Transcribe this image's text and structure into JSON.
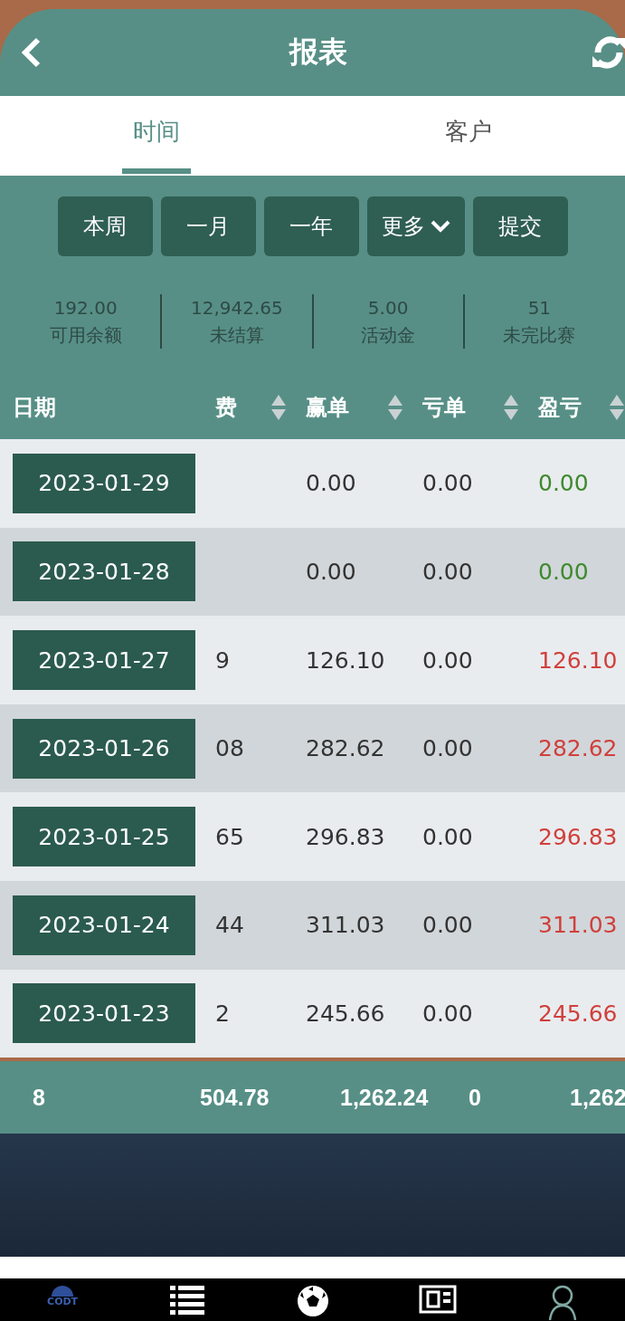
{
  "header": {
    "title": "报表"
  },
  "tabs": [
    {
      "label": "时间",
      "selected": true
    },
    {
      "label": "客户",
      "selected": false
    }
  ],
  "period_buttons": [
    {
      "label": "本周",
      "kind": "plain"
    },
    {
      "label": "一月",
      "kind": "plain"
    },
    {
      "label": "一年",
      "kind": "plain"
    },
    {
      "label": "更多",
      "kind": "dropdown"
    },
    {
      "label": "提交",
      "kind": "plain"
    }
  ],
  "summary": [
    {
      "value": "192.00",
      "label": "可用余额"
    },
    {
      "value": "12,942.65",
      "label": "未结算"
    },
    {
      "value": "5.00",
      "label": "活动金"
    },
    {
      "value": "51",
      "label": "未完比赛"
    }
  ],
  "table": {
    "columns": [
      {
        "label": "日期",
        "sortable": false
      },
      {
        "label": "费",
        "sortable": true
      },
      {
        "label": "赢单",
        "sortable": true
      },
      {
        "label": "亏单",
        "sortable": true
      },
      {
        "label": "盈亏",
        "sortable": true
      }
    ],
    "rows": [
      {
        "date": "2023-01-29",
        "win": "0.00",
        "loss": "0.00",
        "profit": "0.00",
        "color": "#3f8a2e"
      },
      {
        "date": "2023-01-28",
        "win": "0.00",
        "loss": "0.00",
        "profit": "0.00",
        "color": "#3f8a2e"
      },
      {
        "date": "2023-01-27",
        "fee": "9",
        "win": "126.10",
        "loss": "0.00",
        "profit": "126.10",
        "color": "#d0403c"
      },
      {
        "date": "2023-01-26",
        "fee": "08",
        "win": "282.62",
        "loss": "0.00",
        "profit": "282.62",
        "color": "#d0403c"
      },
      {
        "date": "2023-01-25",
        "fee": "65",
        "win": "296.83",
        "loss": "0.00",
        "profit": "296.83",
        "color": "#d0403c"
      },
      {
        "date": "2023-01-24",
        "fee": "44",
        "win": "311.03",
        "loss": "0.00",
        "profit": "311.03",
        "color": "#d0403c"
      },
      {
        "date": "2023-01-23",
        "fee": "2",
        "win": "245.66",
        "loss": "0.00",
        "profit": "245.66",
        "color": "#d0403c"
      }
    ],
    "totals": [
      "8",
      "504.78",
      "1,262.24",
      "0",
      "1,262"
    ]
  },
  "bottom_nav": [
    {
      "kind": "logo",
      "label": "CODT"
    },
    {
      "kind": "list"
    },
    {
      "kind": "ball"
    },
    {
      "kind": "tickets"
    },
    {
      "kind": "user"
    }
  ]
}
